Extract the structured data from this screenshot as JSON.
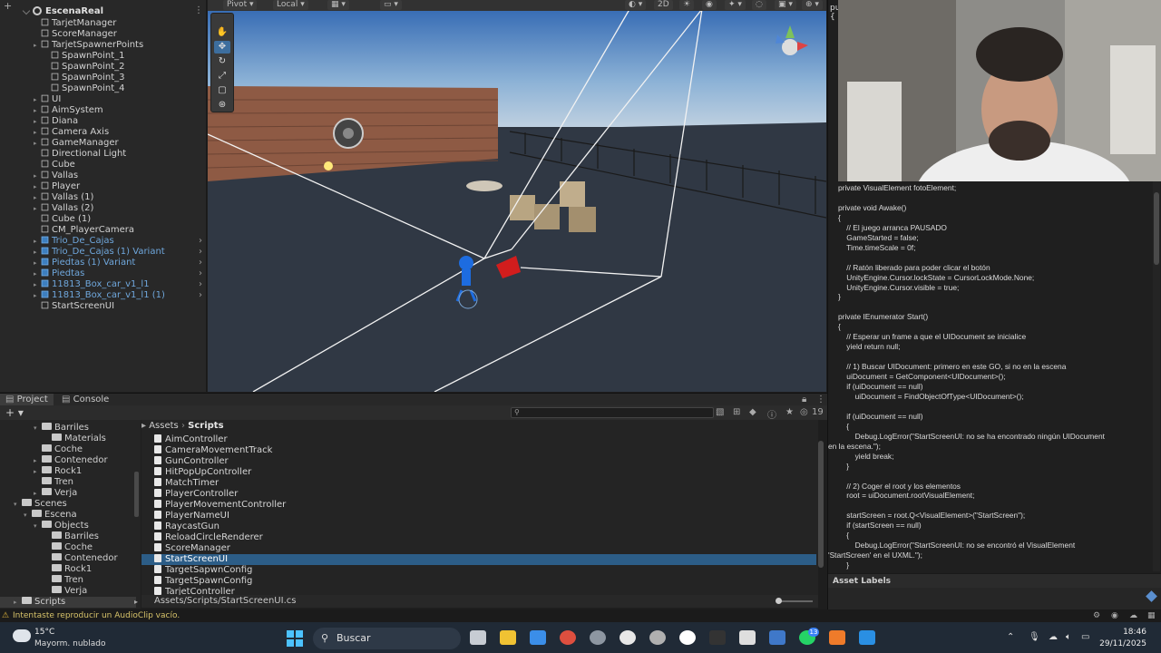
{
  "hierarchy": {
    "scene_name": "EscenaReal",
    "items": [
      {
        "label": "TarjetManager",
        "prefab": false
      },
      {
        "label": "ScoreManager",
        "prefab": false
      },
      {
        "label": "TarjetSpawnerPoints",
        "prefab": false
      },
      {
        "label": "SpawnPoint_1",
        "prefab": false
      },
      {
        "label": "SpawnPoint_2",
        "prefab": false
      },
      {
        "label": "SpawnPoint_3",
        "prefab": false
      },
      {
        "label": "SpawnPoint_4",
        "prefab": false
      },
      {
        "label": "UI",
        "prefab": false
      },
      {
        "label": "AimSystem",
        "prefab": false
      },
      {
        "label": "Diana",
        "prefab": false
      },
      {
        "label": "Camera Axis",
        "prefab": false
      },
      {
        "label": "GameManager",
        "prefab": false
      },
      {
        "label": "Directional Light",
        "prefab": false
      },
      {
        "label": "Cube",
        "prefab": false
      },
      {
        "label": "Vallas",
        "prefab": false
      },
      {
        "label": "Player",
        "prefab": false
      },
      {
        "label": "Vallas (1)",
        "prefab": false
      },
      {
        "label": "Vallas (2)",
        "prefab": false
      },
      {
        "label": "Cube (1)",
        "prefab": false
      },
      {
        "label": "CM_PlayerCamera",
        "prefab": false
      },
      {
        "label": "Trio_De_Cajas",
        "prefab": true
      },
      {
        "label": "Trio_De_Cajas (1) Variant",
        "prefab": true
      },
      {
        "label": "Piedtas (1) Variant",
        "prefab": true
      },
      {
        "label": "Piedtas",
        "prefab": true
      },
      {
        "label": "11813_Box_car_v1_l1",
        "prefab": true
      },
      {
        "label": "11813_Box_car_v1_l1 (1)",
        "prefab": true
      },
      {
        "label": "StartScreenUI",
        "prefab": false
      }
    ]
  },
  "scene_toolbar": {
    "pivot": "Pivot",
    "local": "Local",
    "mode2d": "2D"
  },
  "project": {
    "tabs": [
      "Project",
      "Console"
    ],
    "breadcrumb_root": "Assets",
    "breadcrumb_current": "Scripts",
    "asset_count": "19",
    "folders": [
      {
        "label": "Barriles",
        "indent": 3
      },
      {
        "label": "Materials",
        "indent": 4
      },
      {
        "label": "Coche",
        "indent": 3
      },
      {
        "label": "Contenedor",
        "indent": 3
      },
      {
        "label": "Rock1",
        "indent": 3
      },
      {
        "label": "Tren",
        "indent": 3
      },
      {
        "label": "Verja",
        "indent": 3
      },
      {
        "label": "Scenes",
        "indent": 1
      },
      {
        "label": "Escena",
        "indent": 2
      },
      {
        "label": "Objects",
        "indent": 3
      },
      {
        "label": "Barriles",
        "indent": 4
      },
      {
        "label": "Coche",
        "indent": 4
      },
      {
        "label": "Contenedor",
        "indent": 4
      },
      {
        "label": "Rock1",
        "indent": 4
      },
      {
        "label": "Tren",
        "indent": 4
      },
      {
        "label": "Verja",
        "indent": 4
      },
      {
        "label": "Scripts",
        "indent": 1
      }
    ],
    "files": [
      "AimController",
      "CameraMovementTrack",
      "GunController",
      "HitPopUpController",
      "MatchTimer",
      "PlayerController",
      "PlayerMovementController",
      "PlayerNameUI",
      "RaycastGun",
      "ReloadCircleRenderer",
      "ScoreManager",
      "StartScreenUI",
      "TargetSapwnConfig",
      "TargetSpawnConfig",
      "TarjetController"
    ],
    "selected_file": "StartScreenUI",
    "path": "Assets/Scripts/StartScreenUI.cs"
  },
  "code": {
    "top_chars": "pu",
    "top_brace": "{",
    "lines": [
      "private VisualElement fotoElement;",
      "",
      "private void Awake()",
      "{",
      "    // El juego arranca PAUSADO",
      "    GameStarted = false;",
      "    Time.timeScale = 0f;",
      "",
      "    // Ratón liberado para poder clicar el botón",
      "    UnityEngine.Cursor.lockState = CursorLockMode.None;",
      "    UnityEngine.Cursor.visible = true;",
      "}",
      "",
      "private IEnumerator Start()",
      "{",
      "    // Esperar un frame a que el UIDocument se inicialice",
      "    yield return null;",
      "",
      "    // 1) Buscar UIDocument: primero en este GO, si no en la escena",
      "    uiDocument = GetComponent<UIDocument>();",
      "    if (uiDocument == null)",
      "        uiDocument = FindObjectOfType<UIDocument>();",
      "",
      "    if (uiDocument == null)",
      "    {",
      "        Debug.LogError(\"StartScreenUI: no se ha encontrado ningún UIDocument",
      "en la escena.\");",
      "        yield break;",
      "    }",
      "",
      "    // 2) Coger el root y los elementos",
      "    root = uiDocument.rootVisualElement;",
      "",
      "    startScreen = root.Q<VisualElement>(\"StartScreen\");",
      "    if (startScreen == null)",
      "    {",
      "        Debug.LogError(\"StartScreenUI: no se encontró el VisualElement",
      "'StartScreen' en el UXML.\");",
      "    }"
    ],
    "asset_labels": "Asset Labels"
  },
  "status_message": "Intentaste reproducir un AudioClip vacío.",
  "taskbar": {
    "weather_temp": "15°C",
    "weather_desc": "Mayorm. nublado",
    "search_placeholder": "Buscar",
    "time": "18:46",
    "date": "29/11/2025",
    "whatsapp_badge": "13"
  },
  "colors": {
    "accent": "#2c5d87",
    "prefab": "#6fa7dc",
    "status_warning": "#d7c36a"
  }
}
